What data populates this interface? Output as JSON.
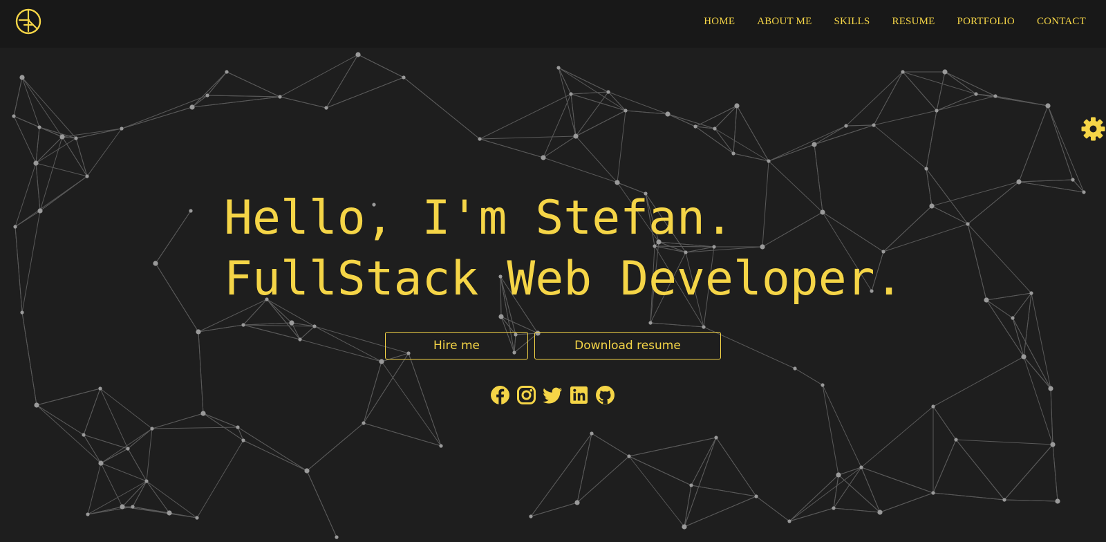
{
  "header": {
    "logo_icon": "monogram-logo-icon",
    "nav": [
      {
        "label": "HOME"
      },
      {
        "label": "ABOUT ME"
      },
      {
        "label": "SKILLS"
      },
      {
        "label": "RESUME"
      },
      {
        "label": "PORTFOLIO"
      },
      {
        "label": "CONTACT"
      }
    ]
  },
  "hero": {
    "greeting": "Hello, I'm Stefan.",
    "role": "FullStack Web Developer.",
    "buttons": {
      "hire": "Hire me",
      "download": "Download resume"
    },
    "socials": [
      {
        "icon": "facebook-icon"
      },
      {
        "icon": "instagram-icon"
      },
      {
        "icon": "twitter-icon"
      },
      {
        "icon": "linkedin-icon"
      },
      {
        "icon": "github-icon"
      }
    ]
  },
  "settings": {
    "icon": "gear-icon"
  },
  "colors": {
    "accent": "#f5d547",
    "background": "#1e1e1e",
    "navbar": "#181818",
    "network_lines": "#8a8a8a"
  }
}
